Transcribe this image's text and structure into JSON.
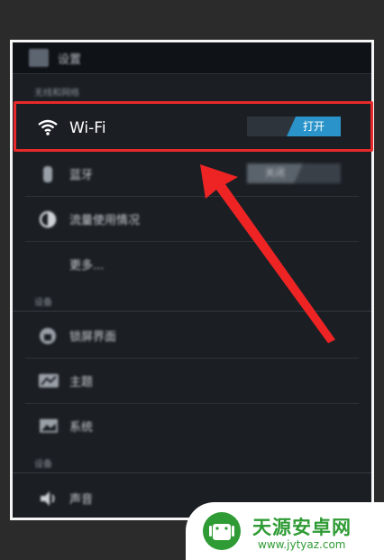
{
  "header": {
    "title": "设置"
  },
  "sections": {
    "wireless": "无线和网络",
    "device": "设备",
    "personal": "设备"
  },
  "wifi": {
    "label": "Wi-Fi",
    "toggle": "打开"
  },
  "bluetooth": {
    "label": "蓝牙",
    "toggle": "关闭"
  },
  "items": {
    "data_usage": "流量使用情况",
    "more": "更多...",
    "lockscreen": "锁屏界面",
    "theme": "主题",
    "display": "系统",
    "sound": "声音"
  },
  "watermark": {
    "name": "天源安卓网",
    "url": "www.jytyaz.com"
  },
  "colors": {
    "highlight": "#e8292a",
    "toggle_on": "#2a93c9",
    "brand_green": "#2e9b34"
  }
}
